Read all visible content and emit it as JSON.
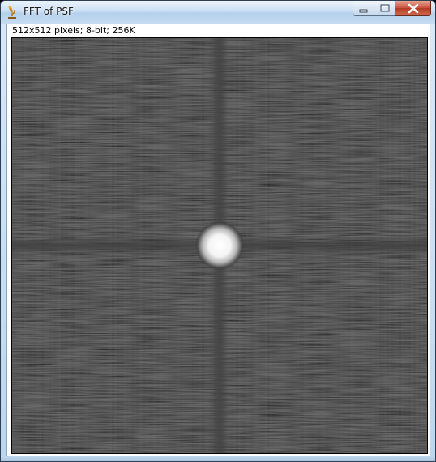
{
  "window": {
    "title": "FFT of PSF",
    "app_icon": "microscope-icon",
    "controls": [
      "minimize-icon",
      "maximize-icon",
      "close-icon"
    ]
  },
  "image_info": "512x512 pixels; 8-bit; 256K",
  "image": {
    "subject": "FFT power spectrum of PSF",
    "colors": {
      "background": "#262626",
      "axis_streak": "#3a3a3a",
      "center_spot": "#ffffff"
    }
  }
}
